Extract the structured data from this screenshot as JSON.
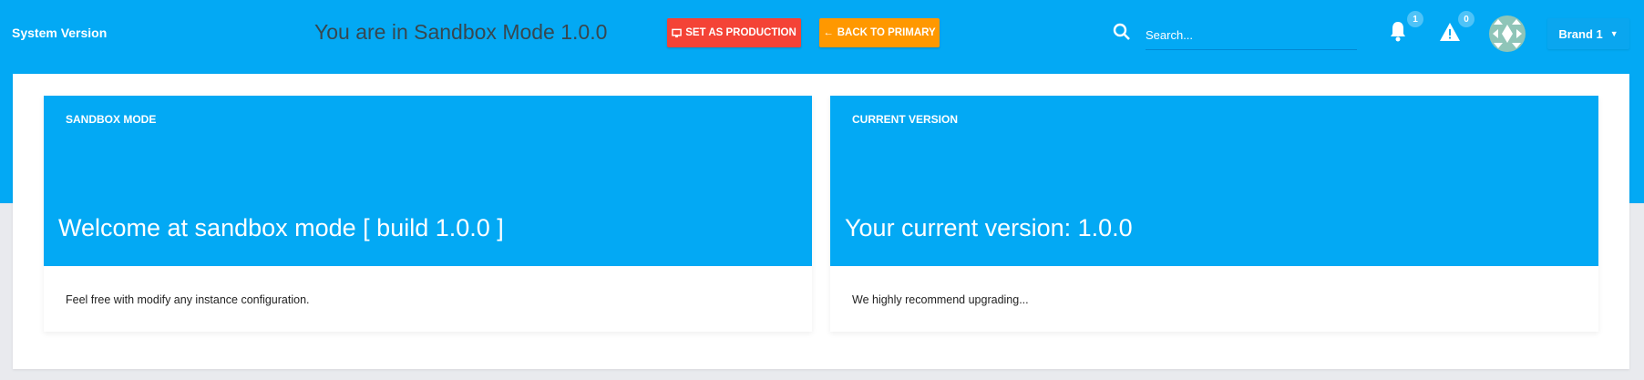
{
  "header": {
    "app_title": "System Version",
    "mode_title": "You are in Sandbox Mode 1.0.0",
    "set_production_label": "SET AS PRODUCTION",
    "back_primary_label": "BACK TO PRIMARY",
    "search_placeholder": "Search...",
    "notifications_count": "1",
    "alerts_count": "0",
    "brand_label": "Brand 1"
  },
  "cards": [
    {
      "label": "SANDBOX MODE",
      "headline": "Welcome at sandbox mode [ build 1.0.0 ]",
      "body": "Feel free with modify any instance configuration."
    },
    {
      "label": "CURRENT VERSION",
      "headline": "Your current version: 1.0.0",
      "body": "We highly recommend upgrading..."
    }
  ],
  "colors": {
    "primary": "#03a9f4",
    "danger": "#f44336",
    "warning": "#ff9800"
  }
}
